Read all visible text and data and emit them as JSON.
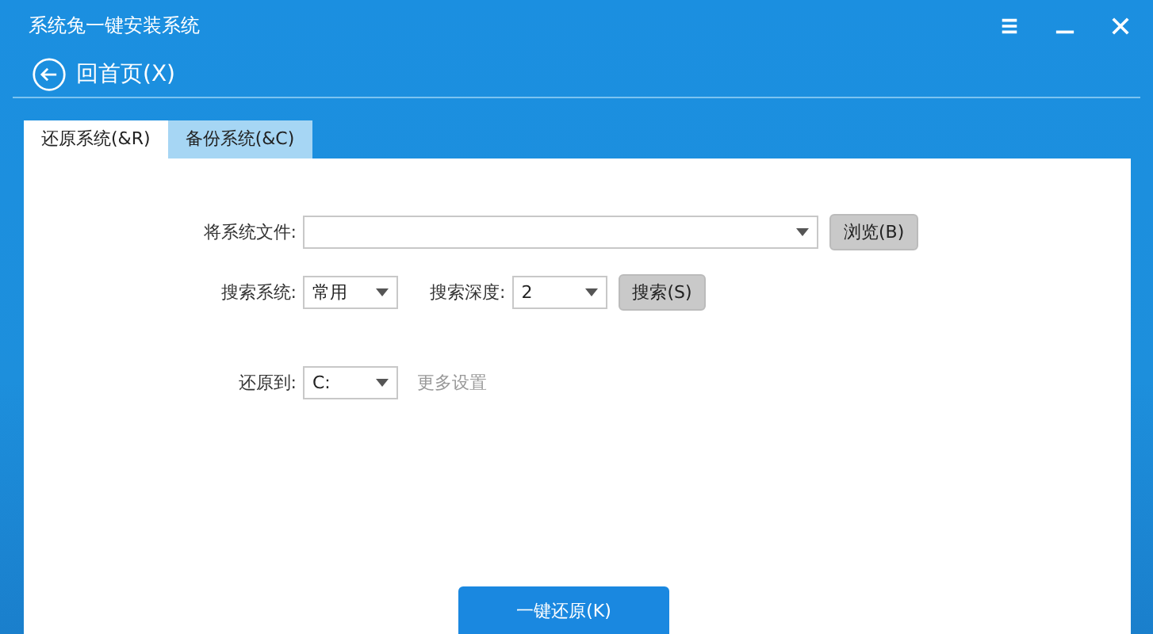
{
  "window": {
    "title": "系统兔一键安装系统"
  },
  "back": {
    "label": "回首页(X)"
  },
  "tabs": [
    {
      "label": "还原系统(&R)",
      "selected": true
    },
    {
      "label": "备份系统(&C)",
      "selected": false
    }
  ],
  "file_row": {
    "label": "将系统文件:",
    "browse_button": "浏览(B)"
  },
  "search_row": {
    "system_label": "搜索系统:",
    "system_value": "常用",
    "depth_label": "搜索深度:",
    "depth_value": "2",
    "search_button": "搜索(S)"
  },
  "restore_row": {
    "label": "还原到:",
    "drive_value": "C:",
    "more_link": "更多设置"
  },
  "primary_button": "一键还原(K)"
}
